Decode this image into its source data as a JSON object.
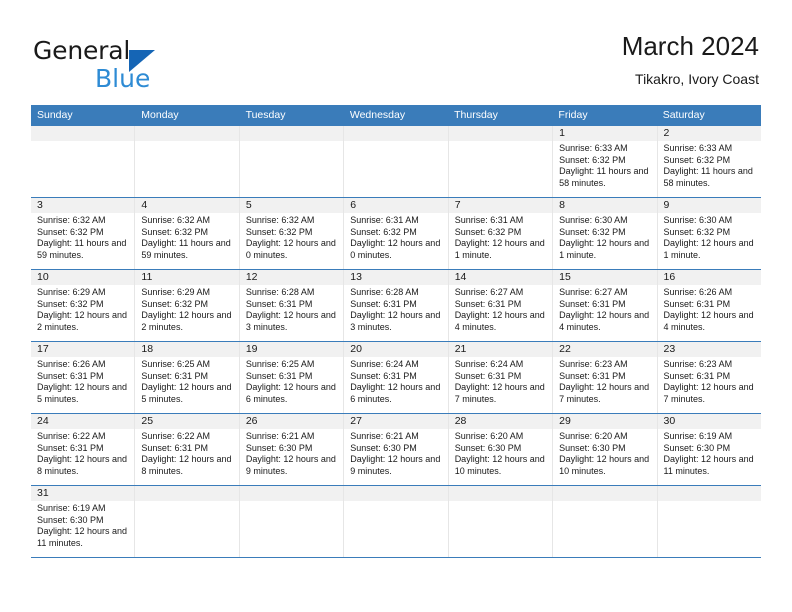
{
  "brand": {
    "line1": "General",
    "line2": "Blue",
    "triangle_color": "#1565b5",
    "blue_text_color": "#2e8bd4"
  },
  "header": {
    "title": "March 2024",
    "subtitle": "Tikakro, Ivory Coast"
  },
  "theme": {
    "header_blue": "#3a7cba",
    "daynum_band": "#f1f1f1",
    "row_divider": "#3a7cba"
  },
  "calendar": {
    "weekdays": [
      "Sunday",
      "Monday",
      "Tuesday",
      "Wednesday",
      "Thursday",
      "Friday",
      "Saturday"
    ],
    "weeks": [
      [
        {
          "day": "",
          "empty": true
        },
        {
          "day": "",
          "empty": true
        },
        {
          "day": "",
          "empty": true
        },
        {
          "day": "",
          "empty": true
        },
        {
          "day": "",
          "empty": true
        },
        {
          "day": "1",
          "sunrise": "Sunrise: 6:33 AM",
          "sunset": "Sunset: 6:32 PM",
          "daylight": "Daylight: 11 hours and 58 minutes."
        },
        {
          "day": "2",
          "sunrise": "Sunrise: 6:33 AM",
          "sunset": "Sunset: 6:32 PM",
          "daylight": "Daylight: 11 hours and 58 minutes."
        }
      ],
      [
        {
          "day": "3",
          "sunrise": "Sunrise: 6:32 AM",
          "sunset": "Sunset: 6:32 PM",
          "daylight": "Daylight: 11 hours and 59 minutes."
        },
        {
          "day": "4",
          "sunrise": "Sunrise: 6:32 AM",
          "sunset": "Sunset: 6:32 PM",
          "daylight": "Daylight: 11 hours and 59 minutes."
        },
        {
          "day": "5",
          "sunrise": "Sunrise: 6:32 AM",
          "sunset": "Sunset: 6:32 PM",
          "daylight": "Daylight: 12 hours and 0 minutes."
        },
        {
          "day": "6",
          "sunrise": "Sunrise: 6:31 AM",
          "sunset": "Sunset: 6:32 PM",
          "daylight": "Daylight: 12 hours and 0 minutes."
        },
        {
          "day": "7",
          "sunrise": "Sunrise: 6:31 AM",
          "sunset": "Sunset: 6:32 PM",
          "daylight": "Daylight: 12 hours and 1 minute."
        },
        {
          "day": "8",
          "sunrise": "Sunrise: 6:30 AM",
          "sunset": "Sunset: 6:32 PM",
          "daylight": "Daylight: 12 hours and 1 minute."
        },
        {
          "day": "9",
          "sunrise": "Sunrise: 6:30 AM",
          "sunset": "Sunset: 6:32 PM",
          "daylight": "Daylight: 12 hours and 1 minute."
        }
      ],
      [
        {
          "day": "10",
          "sunrise": "Sunrise: 6:29 AM",
          "sunset": "Sunset: 6:32 PM",
          "daylight": "Daylight: 12 hours and 2 minutes."
        },
        {
          "day": "11",
          "sunrise": "Sunrise: 6:29 AM",
          "sunset": "Sunset: 6:32 PM",
          "daylight": "Daylight: 12 hours and 2 minutes."
        },
        {
          "day": "12",
          "sunrise": "Sunrise: 6:28 AM",
          "sunset": "Sunset: 6:31 PM",
          "daylight": "Daylight: 12 hours and 3 minutes."
        },
        {
          "day": "13",
          "sunrise": "Sunrise: 6:28 AM",
          "sunset": "Sunset: 6:31 PM",
          "daylight": "Daylight: 12 hours and 3 minutes."
        },
        {
          "day": "14",
          "sunrise": "Sunrise: 6:27 AM",
          "sunset": "Sunset: 6:31 PM",
          "daylight": "Daylight: 12 hours and 4 minutes."
        },
        {
          "day": "15",
          "sunrise": "Sunrise: 6:27 AM",
          "sunset": "Sunset: 6:31 PM",
          "daylight": "Daylight: 12 hours and 4 minutes."
        },
        {
          "day": "16",
          "sunrise": "Sunrise: 6:26 AM",
          "sunset": "Sunset: 6:31 PM",
          "daylight": "Daylight: 12 hours and 4 minutes."
        }
      ],
      [
        {
          "day": "17",
          "sunrise": "Sunrise: 6:26 AM",
          "sunset": "Sunset: 6:31 PM",
          "daylight": "Daylight: 12 hours and 5 minutes."
        },
        {
          "day": "18",
          "sunrise": "Sunrise: 6:25 AM",
          "sunset": "Sunset: 6:31 PM",
          "daylight": "Daylight: 12 hours and 5 minutes."
        },
        {
          "day": "19",
          "sunrise": "Sunrise: 6:25 AM",
          "sunset": "Sunset: 6:31 PM",
          "daylight": "Daylight: 12 hours and 6 minutes."
        },
        {
          "day": "20",
          "sunrise": "Sunrise: 6:24 AM",
          "sunset": "Sunset: 6:31 PM",
          "daylight": "Daylight: 12 hours and 6 minutes."
        },
        {
          "day": "21",
          "sunrise": "Sunrise: 6:24 AM",
          "sunset": "Sunset: 6:31 PM",
          "daylight": "Daylight: 12 hours and 7 minutes."
        },
        {
          "day": "22",
          "sunrise": "Sunrise: 6:23 AM",
          "sunset": "Sunset: 6:31 PM",
          "daylight": "Daylight: 12 hours and 7 minutes."
        },
        {
          "day": "23",
          "sunrise": "Sunrise: 6:23 AM",
          "sunset": "Sunset: 6:31 PM",
          "daylight": "Daylight: 12 hours and 7 minutes."
        }
      ],
      [
        {
          "day": "24",
          "sunrise": "Sunrise: 6:22 AM",
          "sunset": "Sunset: 6:31 PM",
          "daylight": "Daylight: 12 hours and 8 minutes."
        },
        {
          "day": "25",
          "sunrise": "Sunrise: 6:22 AM",
          "sunset": "Sunset: 6:31 PM",
          "daylight": "Daylight: 12 hours and 8 minutes."
        },
        {
          "day": "26",
          "sunrise": "Sunrise: 6:21 AM",
          "sunset": "Sunset: 6:30 PM",
          "daylight": "Daylight: 12 hours and 9 minutes."
        },
        {
          "day": "27",
          "sunrise": "Sunrise: 6:21 AM",
          "sunset": "Sunset: 6:30 PM",
          "daylight": "Daylight: 12 hours and 9 minutes."
        },
        {
          "day": "28",
          "sunrise": "Sunrise: 6:20 AM",
          "sunset": "Sunset: 6:30 PM",
          "daylight": "Daylight: 12 hours and 10 minutes."
        },
        {
          "day": "29",
          "sunrise": "Sunrise: 6:20 AM",
          "sunset": "Sunset: 6:30 PM",
          "daylight": "Daylight: 12 hours and 10 minutes."
        },
        {
          "day": "30",
          "sunrise": "Sunrise: 6:19 AM",
          "sunset": "Sunset: 6:30 PM",
          "daylight": "Daylight: 12 hours and 11 minutes."
        }
      ],
      [
        {
          "day": "31",
          "sunrise": "Sunrise: 6:19 AM",
          "sunset": "Sunset: 6:30 PM",
          "daylight": "Daylight: 12 hours and 11 minutes."
        },
        {
          "day": "",
          "empty": true
        },
        {
          "day": "",
          "empty": true
        },
        {
          "day": "",
          "empty": true
        },
        {
          "day": "",
          "empty": true
        },
        {
          "day": "",
          "empty": true
        },
        {
          "day": "",
          "empty": true
        }
      ]
    ]
  }
}
